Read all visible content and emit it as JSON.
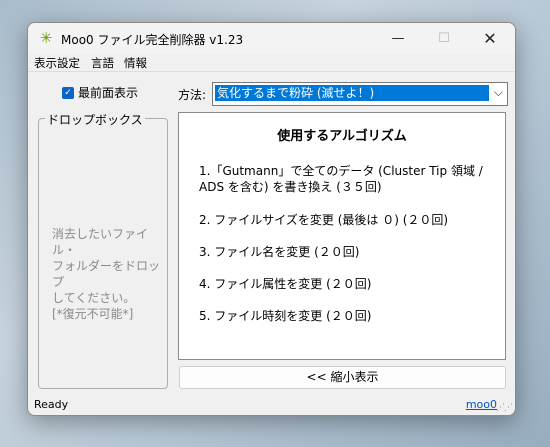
{
  "window": {
    "title": "Moo0 ファイル完全削除器 v1.23",
    "controls": {
      "minimize": "—",
      "maximize": "☐",
      "close": "✕"
    },
    "app_icon": "✳"
  },
  "menu": [
    "表示設定",
    "言語",
    "情報"
  ],
  "topmost_checkbox": {
    "label": "最前面表示",
    "checked": true,
    "check_glyph": "✓"
  },
  "dropbox": {
    "legend": "ドロップボックス",
    "lines": [
      "消去したいファイル・",
      "フォルダーをドロップ",
      "してください。",
      "[*復元不可能*]"
    ]
  },
  "method": {
    "label": "方法:",
    "selected": "気化するまで粉砕 (滅せよ！)",
    "chevron": "⌵"
  },
  "algorithm": {
    "heading": "使用するアルゴリズム",
    "steps": [
      "1.「Gutmann」で全てのデータ (Cluster Tip 領域 / ADS を含む) を書き換え (３５回)",
      "2. ファイルサイズを変更 (最後は ０) (２０回)",
      "3. ファイル名を変更 (２０回)",
      "4. ファイル属性を変更 (２０回)",
      "5. ファイル時刻を変更 (２０回)"
    ]
  },
  "shrink_button": "<< 縮小表示",
  "status": {
    "text": "Ready",
    "link": "moo0"
  }
}
